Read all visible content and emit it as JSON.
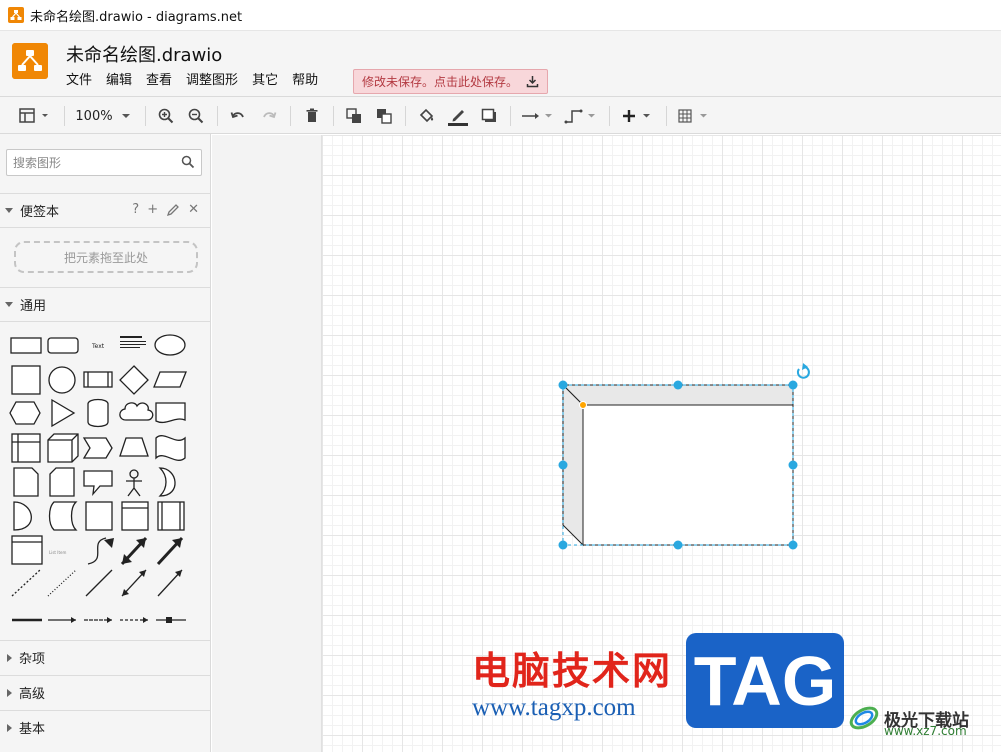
{
  "window": {
    "title": "未命名绘图.drawio - diagrams.net"
  },
  "header": {
    "doc_title": "未命名绘图.drawio",
    "menus": [
      "文件",
      "编辑",
      "查看",
      "调整图形",
      "其它",
      "帮助"
    ],
    "unsaved_notice": "修改未保存。点击此处保存。"
  },
  "toolbar": {
    "zoom": "100%"
  },
  "sidebar": {
    "search_placeholder": "搜索图形",
    "scratchpad": {
      "label": "便签本",
      "drop_hint": "把元素拖至此处",
      "help": "?",
      "add": "+",
      "close": "✕"
    },
    "sections": {
      "general": "通用",
      "misc": "杂项",
      "advanced": "高级",
      "basic": "基本"
    }
  },
  "watermark": {
    "cn_text": "电脑技术网",
    "url": "www.tagxp.com",
    "tag": "TAG",
    "site_name": "极光下载站",
    "site_url": "www.xz7.com"
  },
  "colors": {
    "accent": "#f08705",
    "selection": "#29a8e0",
    "unsaved_bg": "#f8d7da",
    "unsaved_text": "#b33a42"
  }
}
